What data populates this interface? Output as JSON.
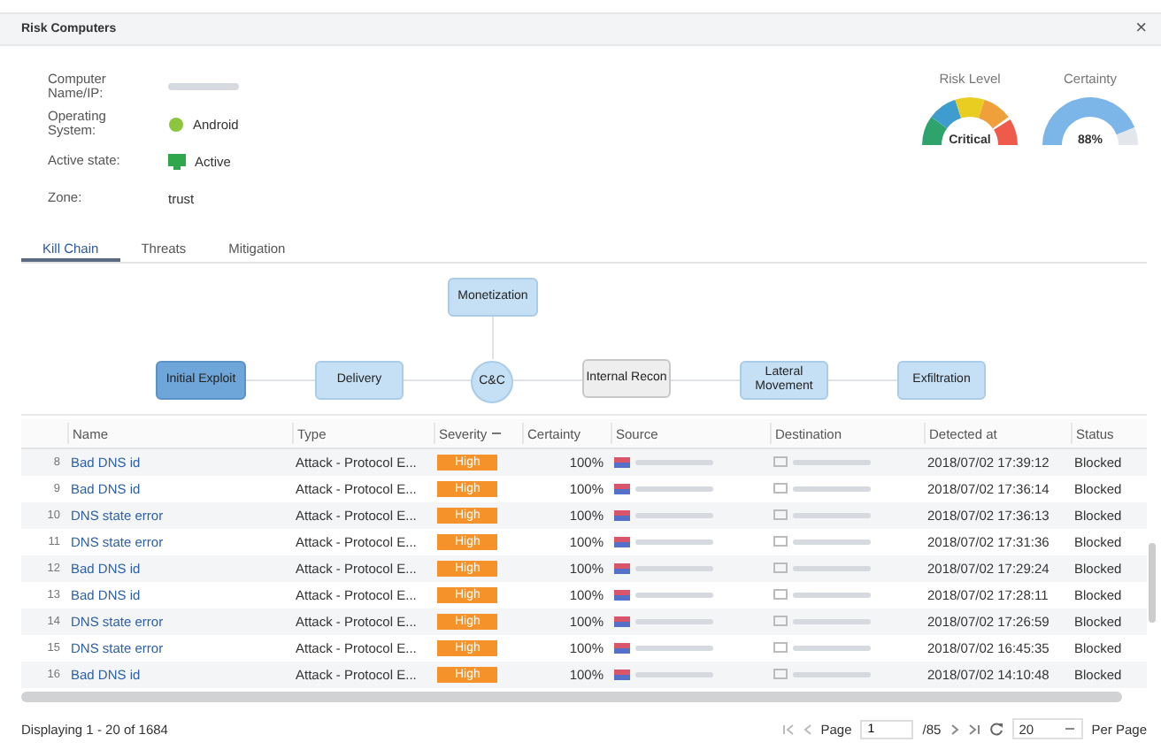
{
  "window": {
    "title": "Risk Computers",
    "close": "×"
  },
  "info": [
    {
      "label": "Computer Name/IP:",
      "kind": "redacted"
    },
    {
      "label": "Operating System:",
      "kind": "os",
      "value": "Android"
    },
    {
      "label": "Active state:",
      "kind": "state",
      "value": "Active"
    },
    {
      "label": "Zone:",
      "kind": "text",
      "value": "trust"
    }
  ],
  "gauges": [
    {
      "title": "Risk Level",
      "kind": "risk",
      "reading": "Critical"
    },
    {
      "title": "Certainty",
      "kind": "certainty",
      "reading": "88%"
    }
  ],
  "tabs": [
    {
      "label": "Kill Chain",
      "selected": true
    },
    {
      "label": "Threats",
      "selected": false
    },
    {
      "label": "Mitigation",
      "selected": false
    }
  ],
  "kill_chain": {
    "stages": [
      {
        "label": "Initial Exploit",
        "kind": "box",
        "selected": true,
        "disabled": false
      },
      {
        "label": "Delivery",
        "kind": "box",
        "selected": false,
        "disabled": false
      },
      {
        "label": "C&C",
        "kind": "circle",
        "selected": false,
        "disabled": false
      },
      {
        "label": "Internal Recon",
        "kind": "box",
        "selected": false,
        "disabled": true
      },
      {
        "label": "Lateral Movement",
        "kind": "box",
        "selected": false,
        "disabled": false
      },
      {
        "label": "Exfiltration",
        "kind": "box",
        "selected": false,
        "disabled": false
      }
    ],
    "branch": {
      "label": "Monetization",
      "selected": false,
      "disabled": false
    }
  },
  "table": {
    "columns": [
      "Name",
      "Type",
      "Severity",
      "Certainty",
      "Source",
      "Destination",
      "Detected at",
      "Status"
    ],
    "rows": [
      {
        "index": "8",
        "name": "Bad DNS id",
        "type": "Attack - Protocol E...",
        "severity": "High",
        "certainty": "100%",
        "detected": "2018/07/02 17:39:12",
        "status": "Blocked"
      },
      {
        "index": "9",
        "name": "Bad DNS id",
        "type": "Attack - Protocol E...",
        "severity": "High",
        "certainty": "100%",
        "detected": "2018/07/02 17:36:14",
        "status": "Blocked"
      },
      {
        "index": "10",
        "name": "DNS state error",
        "type": "Attack - Protocol E...",
        "severity": "High",
        "certainty": "100%",
        "detected": "2018/07/02 17:36:13",
        "status": "Blocked"
      },
      {
        "index": "11",
        "name": "DNS state error",
        "type": "Attack - Protocol E...",
        "severity": "High",
        "certainty": "100%",
        "detected": "2018/07/02 17:31:36",
        "status": "Blocked"
      },
      {
        "index": "12",
        "name": "Bad DNS id",
        "type": "Attack - Protocol E...",
        "severity": "High",
        "certainty": "100%",
        "detected": "2018/07/02 17:29:24",
        "status": "Blocked"
      },
      {
        "index": "13",
        "name": "Bad DNS id",
        "type": "Attack - Protocol E...",
        "severity": "High",
        "certainty": "100%",
        "detected": "2018/07/02 17:28:11",
        "status": "Blocked"
      },
      {
        "index": "14",
        "name": "DNS state error",
        "type": "Attack - Protocol E...",
        "severity": "High",
        "certainty": "100%",
        "detected": "2018/07/02 17:26:59",
        "status": "Blocked"
      },
      {
        "index": "15",
        "name": "DNS state error",
        "type": "Attack - Protocol E...",
        "severity": "High",
        "certainty": "100%",
        "detected": "2018/07/02 16:45:35",
        "status": "Blocked"
      },
      {
        "index": "16",
        "name": "Bad DNS id",
        "type": "Attack - Protocol E...",
        "severity": "High",
        "certainty": "100%",
        "detected": "2018/07/02 14:10:48",
        "status": "Blocked"
      }
    ]
  },
  "footer": {
    "summary": "Displaying 1 - 20 of 1684",
    "page_label": "Page",
    "page": "1",
    "total": "/85",
    "per_page": "20",
    "per_page_label": "Per Page"
  }
}
